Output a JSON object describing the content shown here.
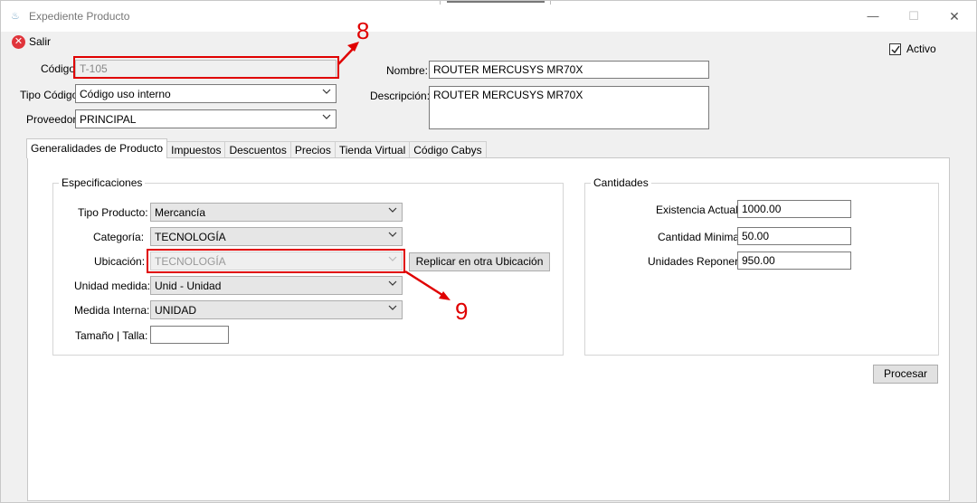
{
  "window": {
    "title": "Expediente Producto",
    "minimize": "—",
    "maximize": "☐",
    "close": "✕"
  },
  "toolbar": {
    "salir_label": "Salir"
  },
  "header": {
    "codigo_label": "Código:",
    "codigo_value": "T-105",
    "tipo_codigo_label": "Tipo Código:",
    "tipo_codigo_value": "Código uso interno",
    "proveedor_label": "Proveedor:",
    "proveedor_value": "PRINCIPAL",
    "nombre_label": "Nombre:",
    "nombre_value": "ROUTER MERCUSYS MR70X",
    "descripcion_label": "Descripción:",
    "descripcion_value": "ROUTER MERCUSYS MR70X",
    "activo_label": "Activo",
    "activo_checked": true
  },
  "tabs": [
    {
      "label": "Generalidades de Producto",
      "active": true
    },
    {
      "label": "Impuestos"
    },
    {
      "label": "Descuentos"
    },
    {
      "label": "Precios"
    },
    {
      "label": "Tienda Virtual"
    },
    {
      "label": "Código Cabys"
    }
  ],
  "especificaciones": {
    "title": "Especificaciones",
    "tipo_producto_label": "Tipo Producto:",
    "tipo_producto_value": "Mercancía",
    "categoria_label": "Categoría:",
    "categoria_value": "TECNOLOGÍA",
    "ubicacion_label": "Ubicación:",
    "ubicacion_value": "TECNOLOGÍA",
    "replicar_button": "Replicar en otra Ubicación",
    "unidad_medida_label": "Unidad medida:",
    "unidad_medida_value": "Unid - Unidad",
    "medida_interna_label": "Medida Interna:",
    "medida_interna_value": "UNIDAD",
    "tamano_label": "Tamaño | Talla:",
    "tamano_value": ""
  },
  "cantidades": {
    "title": "Cantidades",
    "existencia_label": "Existencia Actual:",
    "existencia_value": "1000.00",
    "cantidad_minima_label": "Cantidad Minima:",
    "cantidad_minima_value": "50.00",
    "unidades_reponer_label": "Unidades Reponer:",
    "unidades_reponer_value": "950.00"
  },
  "procesar_button": "Procesar",
  "annotations": {
    "marker_8": "8",
    "marker_9": "9",
    "color": "#e00000"
  }
}
